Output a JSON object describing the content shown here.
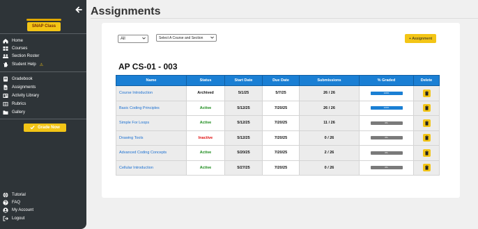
{
  "app": {
    "logo_text": "SNAP Class",
    "page_title": "Assignments"
  },
  "colors": {
    "sidebar": "#2e3438",
    "accent_yellow": "#f3c516",
    "header_blue": "#1a7fd4",
    "link_blue": "#1a6fd0",
    "active_green": "#1a8a1a",
    "inactive_red": "#e01010"
  },
  "sidebar": {
    "collapse_icon": "arrow-left-icon",
    "main_items": [
      {
        "label": "Home",
        "icon": "home-icon"
      },
      {
        "label": "Courses",
        "icon": "courses-icon"
      },
      {
        "label": "Section Roster",
        "icon": "roster-icon"
      },
      {
        "label": "Student Help",
        "icon": "hand-icon",
        "badge": "⚠"
      }
    ],
    "tools_items": [
      {
        "label": "Gradebook",
        "icon": "gradebook-icon"
      },
      {
        "label": "Assignments",
        "icon": "assignments-icon"
      },
      {
        "label": "Activity Library",
        "icon": "library-icon"
      },
      {
        "label": "Rubrics",
        "icon": "rubrics-icon"
      },
      {
        "label": "Gallery",
        "icon": "gallery-icon"
      }
    ],
    "grade_now_label": "Grade Now",
    "footer_items": [
      {
        "label": "Tutorial",
        "icon": "globe-icon"
      },
      {
        "label": "FAQ",
        "icon": "question-icon"
      },
      {
        "label": "My Account",
        "icon": "user-icon"
      },
      {
        "label": "Logout",
        "icon": "logout-icon"
      }
    ]
  },
  "filters": {
    "status_selected": "All",
    "course_selected": "Select A Course and Section"
  },
  "add_assignment_label": "+ Assignment",
  "section_title": "AP CS-01 - 003",
  "table": {
    "headers": [
      "Name",
      "Status",
      "Start Date",
      "Due Date",
      "Submissions",
      "% Graded",
      "Delete"
    ],
    "rows": [
      {
        "name": "Course Introduction",
        "status": "Archived",
        "status_class": "st-archived",
        "start": "5/1/25",
        "due": "5/7/25",
        "submissions": "26 / 26",
        "graded_pct": 100,
        "graded_label": "100%"
      },
      {
        "name": "Basic Coding Principles",
        "status": "Active",
        "status_class": "st-active",
        "start": "5/12/25",
        "due": "7/20/25",
        "submissions": "26 / 26",
        "graded_pct": 100,
        "graded_label": "100%"
      },
      {
        "name": "Simple For Loops",
        "status": "Active",
        "status_class": "st-active",
        "start": "5/12/25",
        "due": "7/20/25",
        "submissions": "11 / 26",
        "graded_pct": 0,
        "graded_label": "0%"
      },
      {
        "name": "Drawing Tools",
        "status": "Inactive",
        "status_class": "st-inactive",
        "start": "5/12/25",
        "due": "7/20/25",
        "submissions": "0 / 26",
        "graded_pct": 0,
        "graded_label": "0%"
      },
      {
        "name": "Advanced Coding Concepts",
        "status": "Active",
        "status_class": "st-active",
        "start": "5/20/25",
        "due": "7/20/25",
        "submissions": "2 / 26",
        "graded_pct": 0,
        "graded_label": "0%"
      },
      {
        "name": "Cellular Introduction",
        "status": "Active",
        "status_class": "st-active",
        "start": "5/27/25",
        "due": "7/20/25",
        "submissions": "0 / 26",
        "graded_pct": 0,
        "graded_label": "0%"
      }
    ]
  }
}
